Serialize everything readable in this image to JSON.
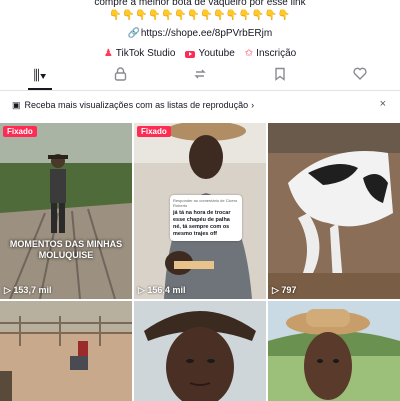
{
  "bio": {
    "line": "compre a melhor bota de vaqueiro por esse link",
    "emojis": "👇👇👇👇👇👇👇👇👇👇👇👇👇👇",
    "link": "https://shope.ee/8pPVrbERjm",
    "social": [
      {
        "label": "TikTok Studio",
        "icon": "person-icon"
      },
      {
        "label": "Youtube",
        "icon": "youtube-icon"
      },
      {
        "label": "Inscrição",
        "icon": "subscription-icon"
      }
    ]
  },
  "tabs": [
    {
      "name": "videos-grid-icon",
      "glyph": "⫼▾",
      "active": true
    },
    {
      "name": "lock-icon",
      "glyph": "🔒",
      "active": false
    },
    {
      "name": "repost-icon",
      "glyph": "⇅",
      "active": false
    },
    {
      "name": "saved-icon",
      "glyph": "🏷",
      "active": false
    },
    {
      "name": "heart-icon",
      "glyph": "♡",
      "active": false
    }
  ],
  "banner": {
    "text": "Receba mais visualizações com as listas de reprodução",
    "chevron": "›",
    "close": "×"
  },
  "videos": [
    {
      "pinned": "Fixado",
      "caption": "MOMENTOS DAS MINHAS MOLUQUISE",
      "views": "▷ 153,7 mil"
    },
    {
      "pinned": "Fixado",
      "views": "▷ 156,4 mil",
      "qa_head": "Responder ao comentário de Cicero Roberto",
      "qa_text": "já tá na hora de trocar esse chapéu de palha né, tá sempre com os mesmo trajes off"
    },
    {
      "views": "▷ 797"
    },
    {},
    {},
    {}
  ],
  "colors": {
    "accent": "#fe2c55",
    "text": "#161823",
    "muted": "#8a8b91"
  }
}
